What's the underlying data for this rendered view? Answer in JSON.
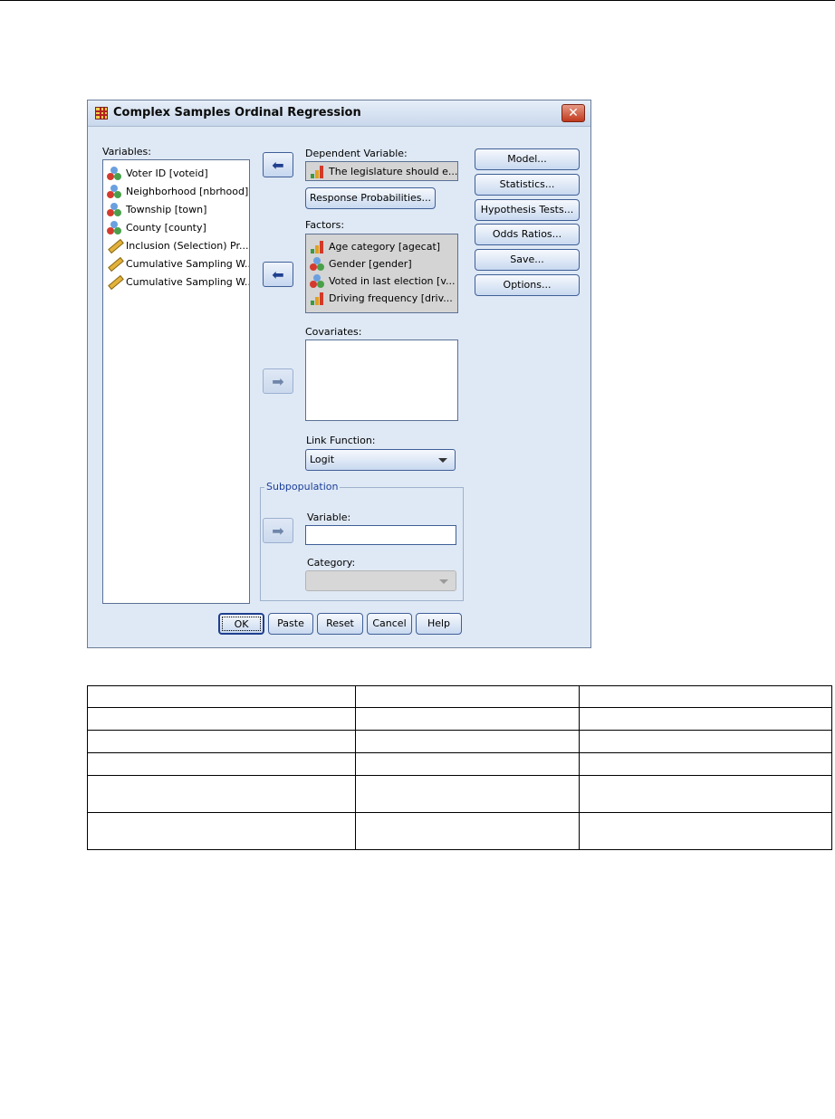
{
  "dialog": {
    "title": "Complex Samples Ordinal Regression",
    "close_glyph": "✕"
  },
  "variables": {
    "label": "Variables:",
    "items": [
      {
        "label": "Voter ID [voteid]",
        "icon": "nominal"
      },
      {
        "label": "Neighborhood [nbrhood]",
        "icon": "nominal"
      },
      {
        "label": "Township [town]",
        "icon": "nominal"
      },
      {
        "label": "County [county]",
        "icon": "nominal"
      },
      {
        "label": "Inclusion (Selection) Pr...",
        "icon": "scale"
      },
      {
        "label": "Cumulative Sampling W...",
        "icon": "scale"
      },
      {
        "label": "Cumulative Sampling W...",
        "icon": "scale"
      }
    ]
  },
  "dependent": {
    "label": "Dependent Variable:",
    "value": "The legislature should e...",
    "icon": "ordinal"
  },
  "response_probabilities_label": "Response Probabilities...",
  "factors": {
    "label": "Factors:",
    "items": [
      {
        "label": "Age category [agecat]",
        "icon": "ordinal"
      },
      {
        "label": "Gender [gender]",
        "icon": "nominal"
      },
      {
        "label": "Voted in last election [v...",
        "icon": "nominal"
      },
      {
        "label": "Driving frequency [driv...",
        "icon": "ordinal"
      }
    ]
  },
  "covariates": {
    "label": "Covariates:"
  },
  "link_function": {
    "label": "Link Function:",
    "value": "Logit"
  },
  "subpopulation": {
    "legend": "Subpopulation",
    "variable_label": "Variable:",
    "variable_value": "",
    "category_label": "Category:",
    "category_value": ""
  },
  "side_buttons": [
    "Model...",
    "Statistics...",
    "Hypothesis Tests...",
    "Odds Ratios...",
    "Save...",
    "Options..."
  ],
  "bottom_buttons": [
    "OK",
    "Paste",
    "Reset",
    "Cancel",
    "Help"
  ],
  "arrow_glyphs": {
    "move_left": "⬅",
    "move_right": "➡"
  },
  "colors": {
    "dialog_bg": "#dfe9f5",
    "button_border": "#3f5f97",
    "close_red": "#c0391c"
  }
}
